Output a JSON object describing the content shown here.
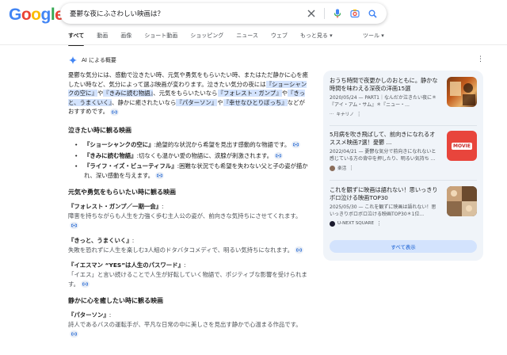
{
  "logo": {
    "letters": [
      "G",
      "o",
      "o",
      "g",
      "l",
      "e"
    ]
  },
  "search": {
    "query": "憂鬱な夜にふさわしい映画は？"
  },
  "tabs": [
    "すべて",
    "動画",
    "画像",
    "ショート動画",
    "ショッピング",
    "ニュース",
    "ウェブ",
    "もっと見る ▾"
  ],
  "tools_label": "ツール ▾",
  "ai": {
    "title": "AI による概要",
    "intro": {
      "t1": "憂鬱な気分には、感動で泣きたい時、元気や勇気をもらいたい時、またはただ静かに心を癒したい時など、気分によって選ぶ映画が変わります。泣きたい気分の夜には",
      "h1": "『ショーシャンクの空に』",
      "t2": "や",
      "h2": "『きみに読む物語』",
      "t3": "、元気をもらいたいなら",
      "h3": "『フォレスト・ガンプ』",
      "t4": "や",
      "h4": "『きっと、うまくいく』",
      "t5": "、静かに癒されたいなら",
      "h5": "『パターソン』",
      "t6": "や",
      "h6": "『幸せなひとりぼっち』",
      "t7": "などがおすすめです。"
    },
    "sec1": {
      "heading": "泣きたい時に観る映画",
      "items": [
        {
          "name": "『ショーシャンクの空に』",
          "desc": ":絶望的な状況から希望を見出す感動的な物語です。"
        },
        {
          "name": "『きみに読む物語』",
          "desc": ":切なくも温かい愛の物語に、涙腺が刺激されます。"
        },
        {
          "name": "『ライフ・イズ・ビューティフル』",
          "desc": ":困難な状況でも希望を失わない父と子の姿が描かれ、深い感動を与えます。"
        }
      ]
    },
    "sec2": {
      "heading": "元気や勇気をもらいたい時に観る映画",
      "items": [
        {
          "name": "『フォレスト・ガンプ／一期一会』",
          "suffix": ":",
          "desc": "障害を持ちながらも人生を力強く歩む主人公の姿が、前向きな気持ちにさせてくれます。"
        },
        {
          "name": "『きっと、うまくいく』",
          "suffix": ":",
          "desc": "失敗を恐れずに人生を楽しむ3人組のドタバタコメディで、明るい気持ちになれます。"
        },
        {
          "name": "『イエスマン “YES”は人生のパスワード』",
          "suffix": ":",
          "desc": "「イエス」と言い続けることで人生が好転していく物語で、ポジティブな影響を受けられます。"
        }
      ]
    },
    "sec3": {
      "heading": "静かに心を癒したい時に観る映画",
      "items": [
        {
          "name": "『パターソン』",
          "suffix": ":",
          "desc": "詩人であるバスの運転手が、平凡な日常の中に美しさを見出す静かで心温まる作品です。"
        }
      ]
    }
  },
  "sources": [
    {
      "title": "おうち時間で夜更かしのおともに。静かな時間を味わえる深夜の洋画15選",
      "meta": "2020/05/24 — PART1｜なんだか泣きたい夜に＊『アイ・アム・サム』＊『ニュー・...",
      "site": "キナリノ"
    },
    {
      "title": "5月病を吹き飛ばして、前向きになれるオススメ映画7選！憂鬱 ...",
      "meta": "2022/04/21 — 憂鬱な気分で前向きになれないと感じている方の背中を押したり、明るい気持ち ...",
      "site": "楽活",
      "thumb_label": "MOVIE"
    },
    {
      "title": "これを観ずに映画は語れない！思いっきりボロ泣ける映画TOP30",
      "meta": "2025/05/30 — これを観ずに映画は語れない！思いっきりボロボロ泣ける映画TOP30＊1位...",
      "site": "U-NEXT SQUARE"
    }
  ],
  "show_all": "すべて表示"
}
